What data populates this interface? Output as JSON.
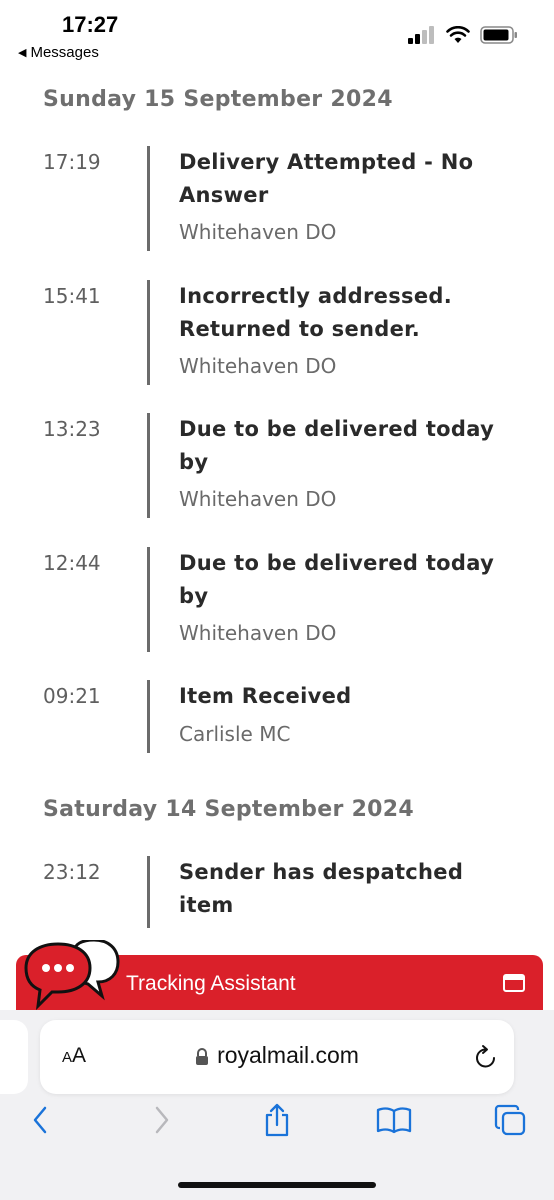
{
  "status_bar": {
    "time": "17:27",
    "back_app": "Messages",
    "icons": [
      "cellular-signal-icon",
      "wifi-icon",
      "battery-icon"
    ]
  },
  "tracking": {
    "days": [
      {
        "date": "Sunday 15 September 2024",
        "events": [
          {
            "time": "17:19",
            "title": "Delivery Attempted - No Answer",
            "location": "Whitehaven DO"
          },
          {
            "time": "15:41",
            "title": "Incorrectly addressed. Returned to sender.",
            "location": "Whitehaven DO"
          },
          {
            "time": "13:23",
            "title": "Due to be delivered today by",
            "location": "Whitehaven DO"
          },
          {
            "time": "12:44",
            "title": "Due to be delivered today by",
            "location": "Whitehaven DO"
          },
          {
            "time": "09:21",
            "title": "Item Received",
            "location": "Carlisle MC"
          }
        ]
      },
      {
        "date": "Saturday 14 September 2024",
        "events": [
          {
            "time": "23:12",
            "title": "Sender has despatched item",
            "location": ""
          }
        ]
      }
    ]
  },
  "assistant": {
    "label": "Tracking Assistant",
    "color": "#da202a",
    "icons": [
      "chat-bubbles-icon",
      "window-icon"
    ]
  },
  "browser": {
    "aa_small": "A",
    "aa_big": "A",
    "url": "royalmail.com",
    "icons": [
      "lock-icon",
      "reload-icon",
      "back-icon",
      "forward-icon",
      "share-icon",
      "bookmarks-icon",
      "tabs-icon"
    ],
    "accent": "#1a73d9"
  }
}
